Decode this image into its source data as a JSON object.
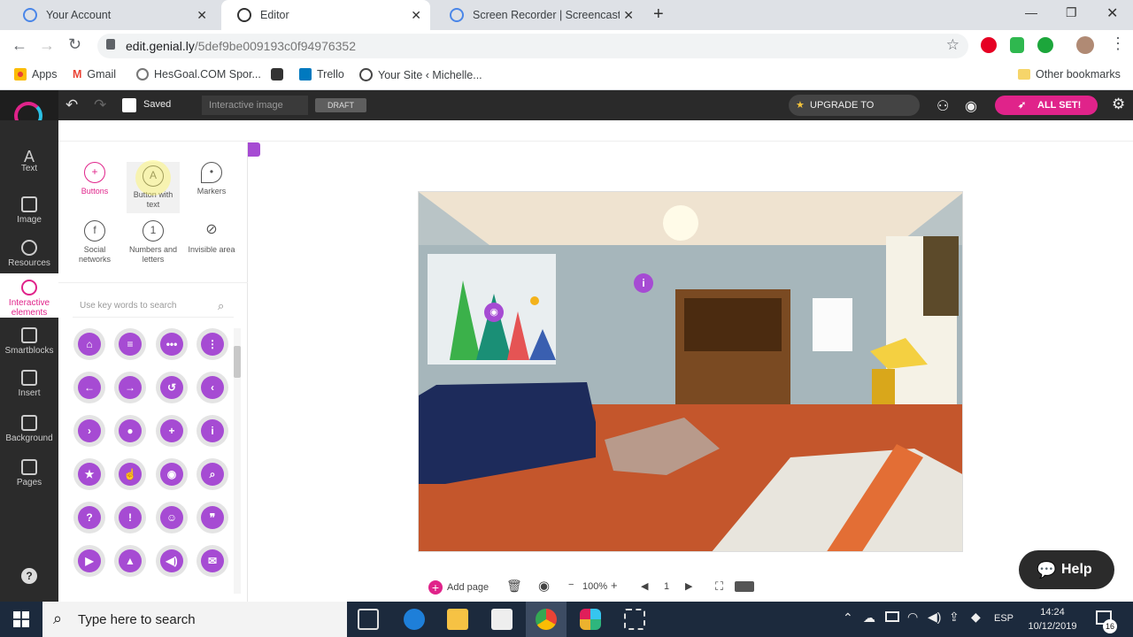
{
  "tabs": [
    {
      "label": "Your Account",
      "active": false
    },
    {
      "label": "Editor",
      "active": true
    },
    {
      "label": "Screen Recorder | Screencast-O-Matic",
      "active": false
    }
  ],
  "address": {
    "host": "edit.genial.ly",
    "path": "/5def9be009193c0f94976352"
  },
  "bookmarks": [
    "Apps",
    "Gmail",
    "HesGoal.COM Spor...",
    "Trello",
    "Your Site ‹ Michelle..."
  ],
  "other_bookmarks": "Other bookmarks",
  "editor": {
    "saved": "Saved",
    "title_placeholder": "Interactive image",
    "draft": "DRAFT",
    "upgrade": "UPGRADE TO PREMIUM",
    "allset": "ALL SET!"
  },
  "rail": [
    "Text",
    "Image",
    "Resources",
    "Interactive elements",
    "Smartblocks",
    "Insert",
    "Background",
    "Pages"
  ],
  "panel": {
    "categories": [
      "Buttons",
      "Button with text",
      "Markers",
      "Social networks",
      "Numbers and letters",
      "Invisible area"
    ],
    "search_placeholder": "Use key words to search",
    "buttons": [
      "⌂",
      "≡",
      "•••",
      "⋮",
      "←",
      "→",
      "↺",
      "‹",
      "›",
      "●",
      "+",
      "i",
      "★",
      "☝",
      "◉",
      "⌕",
      "?",
      "!",
      "☺",
      "❞",
      "▶",
      "▲",
      "◀)",
      "✉"
    ]
  },
  "canvas": {
    "hotspot_i": "i"
  },
  "bottombar": {
    "add_page": "Add page",
    "zoom": "100%",
    "page": "1"
  },
  "help": "Help",
  "taskbar": {
    "search": "Type here to search",
    "lang": "ESP",
    "time": "14:24",
    "date": "10/12/2019",
    "notif": "16"
  },
  "colors": {
    "accent": "#e0238a",
    "purple": "#a64bd3",
    "dark": "#2a2a2a"
  }
}
